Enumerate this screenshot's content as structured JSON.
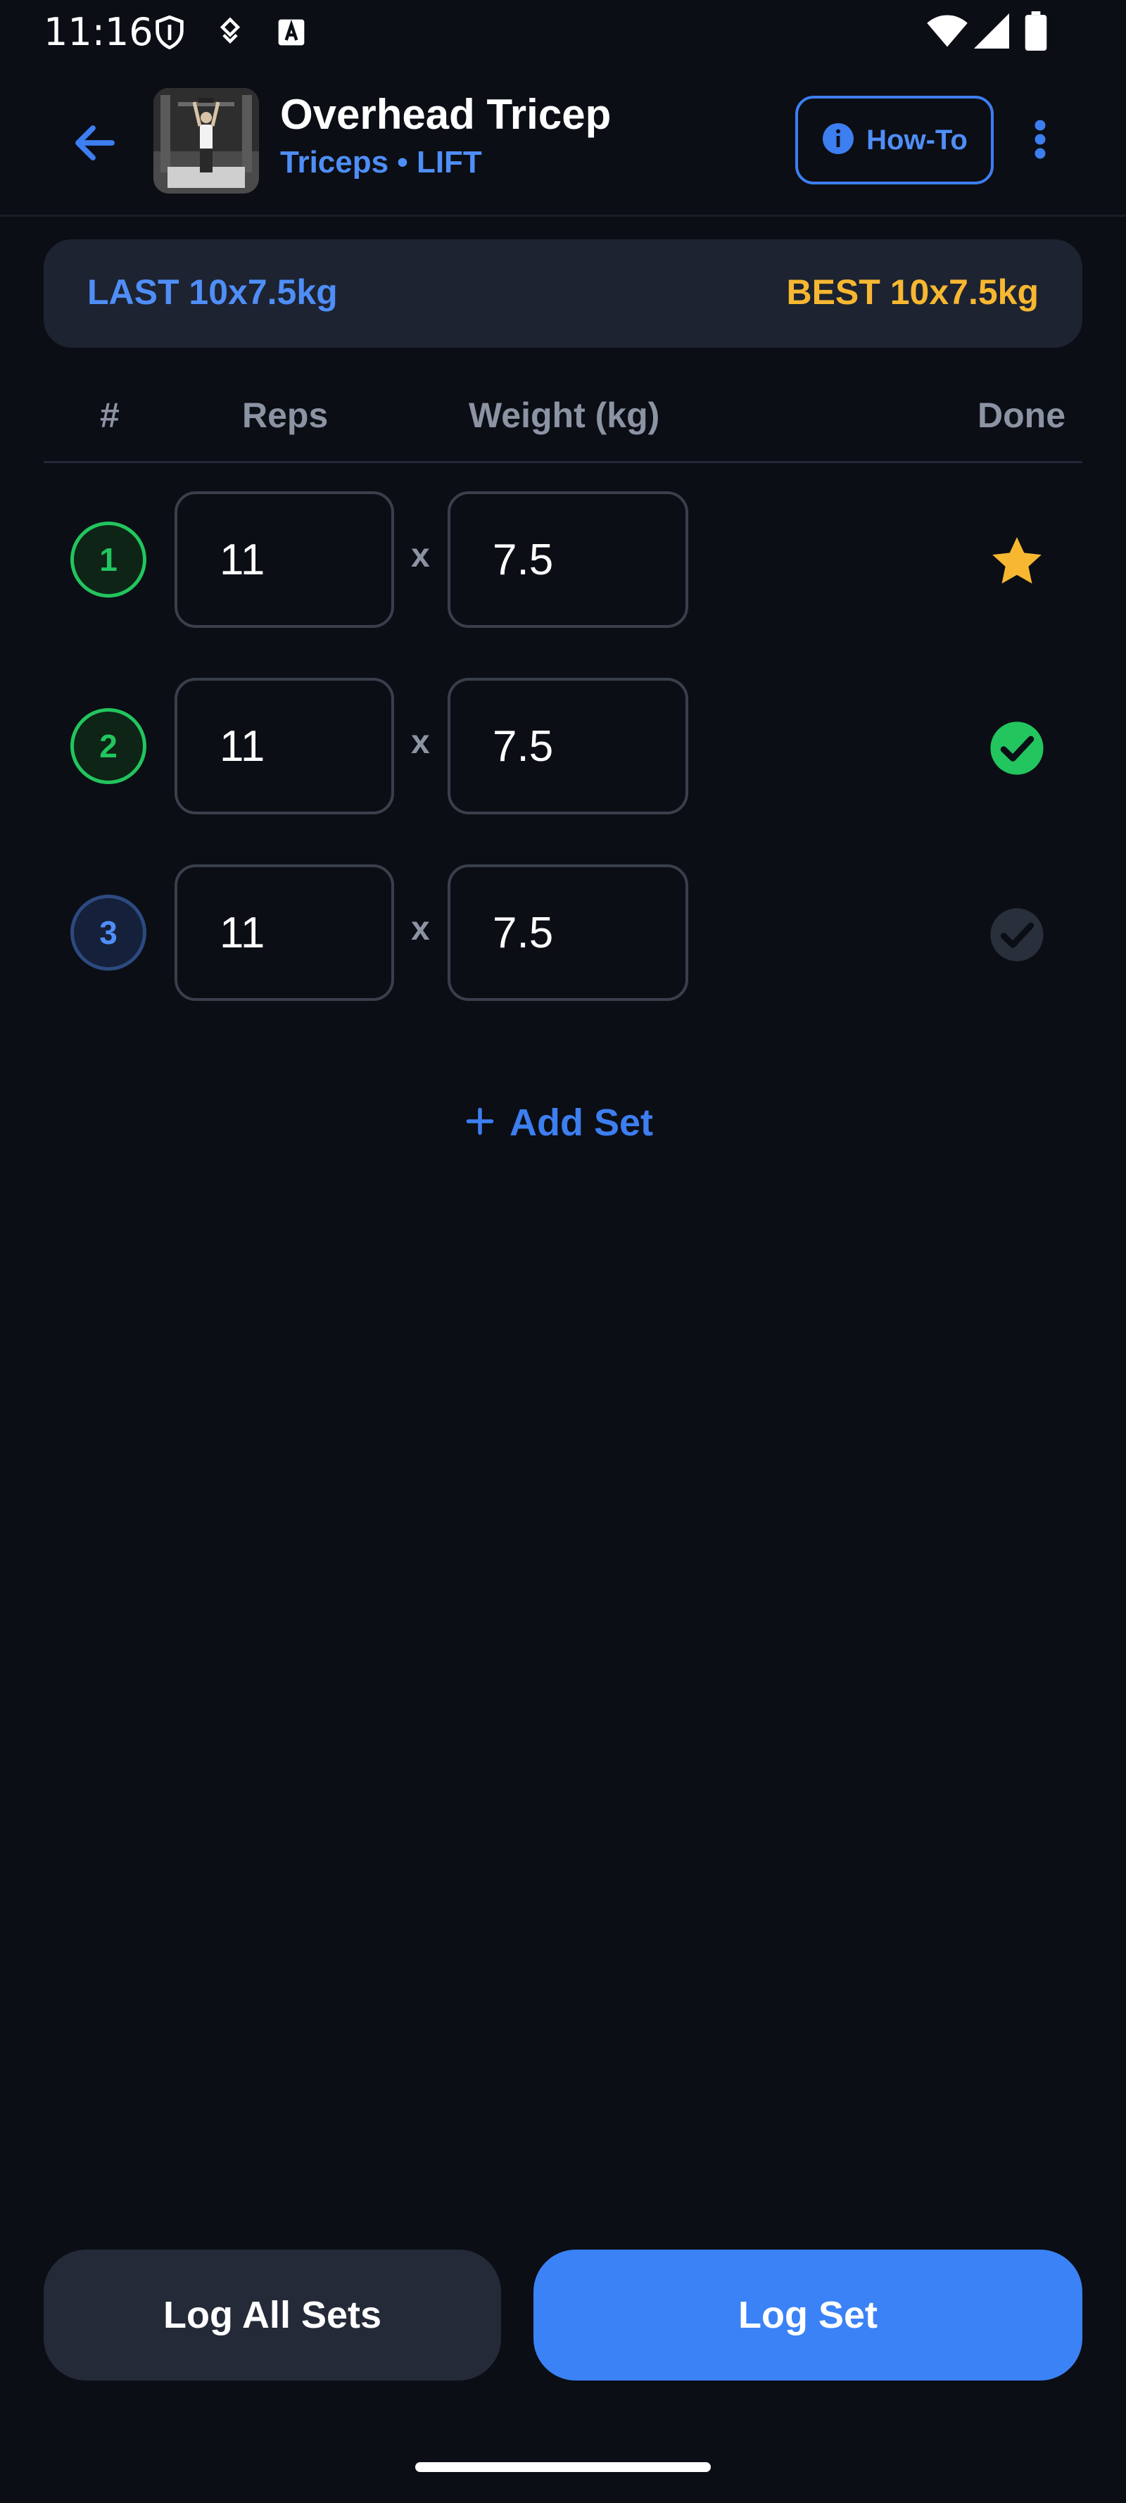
{
  "status_bar": {
    "time": "11:16",
    "icons": [
      "shield-icon",
      "vpn-key-icon",
      "font-a-icon",
      "wifi-icon",
      "signal-icon",
      "battery-icon"
    ]
  },
  "header": {
    "back_icon": "arrow-left-icon",
    "title": "Overhead Tricep",
    "subtitle": "Triceps • LIFT",
    "howto_label": "How-To",
    "howto_icon": "info-icon",
    "more_icon": "more-vertical-icon"
  },
  "history": {
    "last": "LAST 10x7.5kg",
    "best": "BEST 10x7.5kg"
  },
  "table": {
    "headers": {
      "num": "#",
      "reps": "Reps",
      "weight": "Weight (kg)",
      "done": "Done"
    },
    "times_symbol": "x",
    "rows": [
      {
        "num": "1",
        "reps": "11",
        "weight": "7.5",
        "status": "best",
        "status_icon": "star-icon"
      },
      {
        "num": "2",
        "reps": "11",
        "weight": "7.5",
        "status": "done",
        "status_icon": "check-circle-icon"
      },
      {
        "num": "3",
        "reps": "11",
        "weight": "7.5",
        "status": "pending",
        "status_icon": "check-circle-outline-icon"
      }
    ]
  },
  "add_set_label": "Add Set",
  "footer": {
    "log_all_label": "Log All Sets",
    "log_set_label": "Log Set"
  },
  "colors": {
    "background": "#0b0e15",
    "accent_blue": "#3b82f6",
    "green": "#22c55e",
    "gold": "#f7b731",
    "muted": "#8c93a3"
  }
}
